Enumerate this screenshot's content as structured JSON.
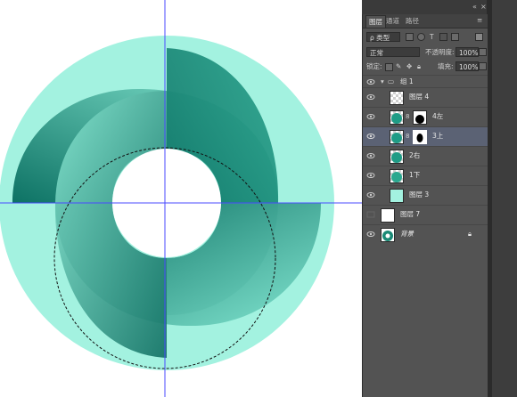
{
  "panel": {
    "tabs": [
      "图层",
      "通道",
      "路径"
    ],
    "collapse_icons": [
      "collapse-icon",
      "close-icon"
    ],
    "filter_label": "ρ 类型",
    "blend_mode": "正常",
    "opacity_label": "不透明度:",
    "opacity_value": "100%",
    "lock_label": "锁定:",
    "fill_label": "填充:",
    "fill_value": "100%"
  },
  "layers": [
    {
      "name": "组 1",
      "type": "group",
      "visible": true
    },
    {
      "name": "图层 4",
      "visible": true
    },
    {
      "name": "4左",
      "visible": true
    },
    {
      "name": "3上",
      "visible": true,
      "selected": true
    },
    {
      "name": "2右",
      "visible": true
    },
    {
      "name": "1下",
      "visible": true
    },
    {
      "name": "图层 3",
      "visible": true
    },
    {
      "name": "图层 7",
      "visible": false
    },
    {
      "name": "背景",
      "visible": true,
      "locked": true
    }
  ],
  "colors": {
    "ring_light": "#a3f2e0",
    "ring_dark": "#0b6e62",
    "panel_bg": "#535353",
    "selected_row": "#5b6274",
    "guide": "#4a4aff"
  }
}
